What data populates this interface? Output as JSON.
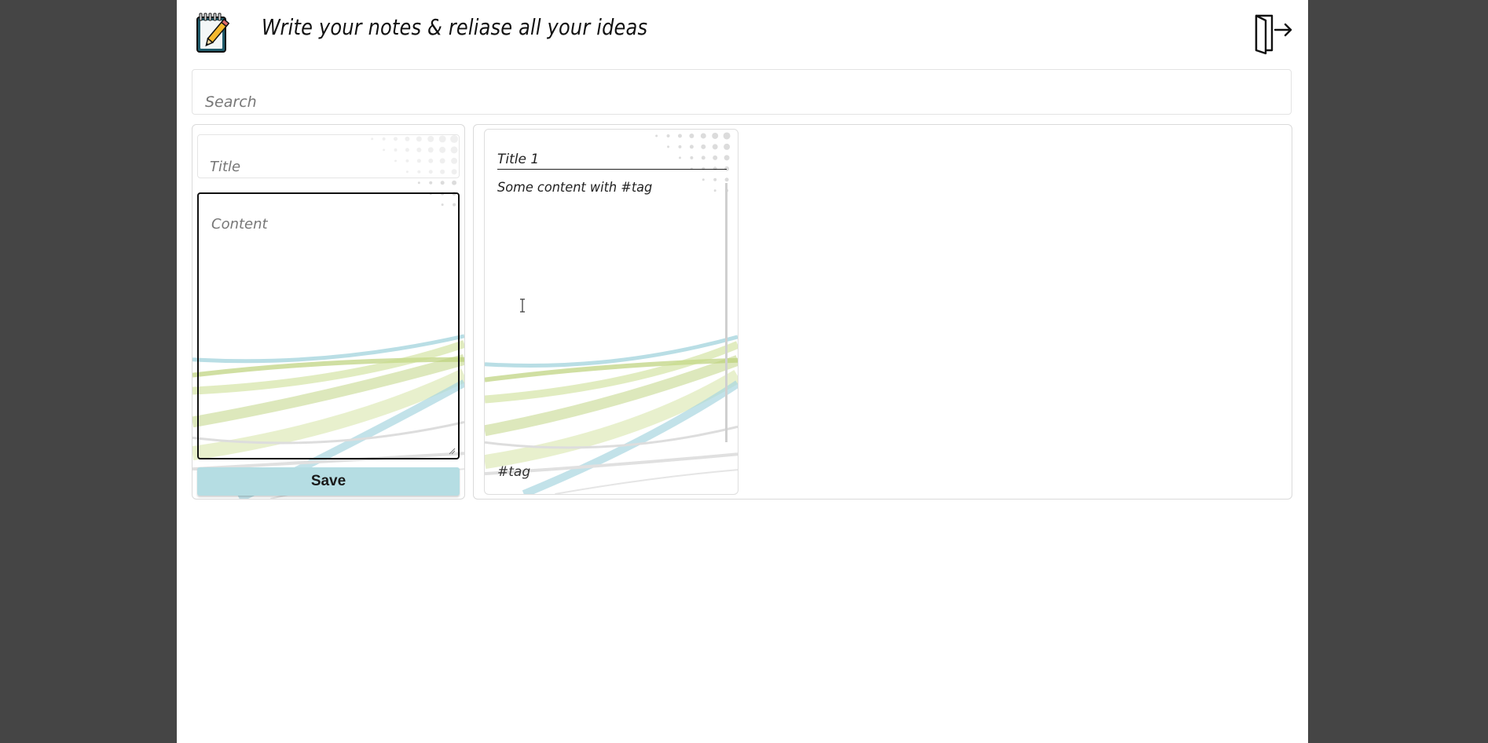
{
  "header": {
    "tagline": "Write your notes & reliase all your ideas",
    "logo_icon": "notepad-pencil-icon",
    "logout_icon": "logout-door-icon"
  },
  "search": {
    "placeholder": "Search",
    "value": ""
  },
  "editor": {
    "title_placeholder": "Title",
    "title_value": "",
    "content_placeholder": "Content",
    "content_value": "",
    "save_label": "Save"
  },
  "notes": [
    {
      "title": "Title 1",
      "content": "Some content with #tag",
      "tag": "#tag"
    }
  ],
  "colors": {
    "page_bg": "#454545",
    "save_button": "#b5dde3",
    "accent_green": "#bcd27a",
    "accent_blue": "#a8d6df"
  }
}
